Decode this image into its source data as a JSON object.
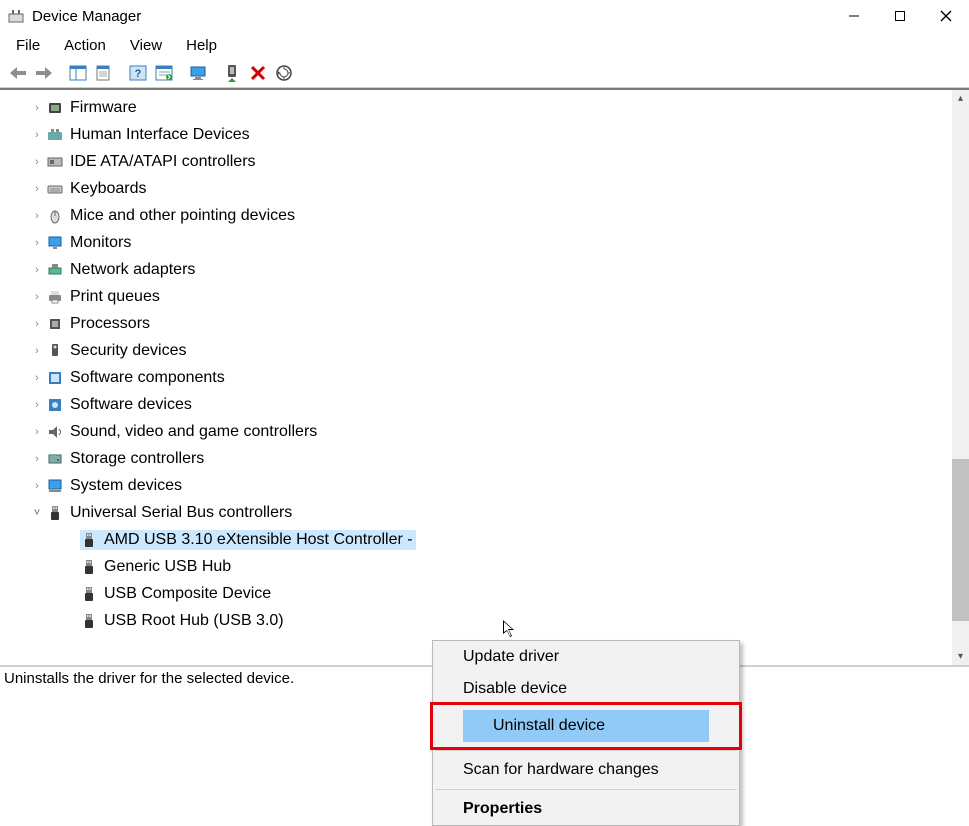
{
  "window": {
    "title": "Device Manager",
    "controls": {
      "minimize": "–",
      "maximize": "☐",
      "close": "✕"
    }
  },
  "menu": {
    "items": [
      "File",
      "Action",
      "View",
      "Help"
    ]
  },
  "toolbar": {
    "buttons": [
      {
        "name": "back",
        "glyph": "arrow-left"
      },
      {
        "name": "forward",
        "glyph": "arrow-right"
      },
      {
        "name": "show-hide-tree",
        "glyph": "panel"
      },
      {
        "name": "properties",
        "glyph": "prop-sheet"
      },
      {
        "name": "help",
        "glyph": "help"
      },
      {
        "name": "action-list",
        "glyph": "sheet"
      },
      {
        "name": "update-driver",
        "glyph": "monitor"
      },
      {
        "name": "enable-device",
        "glyph": "enable"
      },
      {
        "name": "uninstall-device",
        "glyph": "x-red"
      },
      {
        "name": "scan-hardware",
        "glyph": "scan"
      }
    ]
  },
  "tree": {
    "nodes": [
      {
        "label": "Firmware",
        "icon": "firmware",
        "expanded": false
      },
      {
        "label": "Human Interface Devices",
        "icon": "hid",
        "expanded": false
      },
      {
        "label": "IDE ATA/ATAPI controllers",
        "icon": "ide",
        "expanded": false
      },
      {
        "label": "Keyboards",
        "icon": "keyboard",
        "expanded": false
      },
      {
        "label": "Mice and other pointing devices",
        "icon": "mouse",
        "expanded": false
      },
      {
        "label": "Monitors",
        "icon": "monitor",
        "expanded": false
      },
      {
        "label": "Network adapters",
        "icon": "network",
        "expanded": false
      },
      {
        "label": "Print queues",
        "icon": "printer",
        "expanded": false
      },
      {
        "label": "Processors",
        "icon": "cpu",
        "expanded": false
      },
      {
        "label": "Security devices",
        "icon": "security",
        "expanded": false
      },
      {
        "label": "Software components",
        "icon": "swcomp",
        "expanded": false
      },
      {
        "label": "Software devices",
        "icon": "swdev",
        "expanded": false
      },
      {
        "label": "Sound, video and game controllers",
        "icon": "sound",
        "expanded": false
      },
      {
        "label": "Storage controllers",
        "icon": "storage",
        "expanded": false
      },
      {
        "label": "System devices",
        "icon": "system",
        "expanded": false
      },
      {
        "label": "Universal Serial Bus controllers",
        "icon": "usb",
        "expanded": true,
        "children": [
          {
            "label": "AMD USB 3.10 eXtensible Host Controller -",
            "icon": "usb",
            "selected": true
          },
          {
            "label": "Generic USB Hub",
            "icon": "usb"
          },
          {
            "label": "USB Composite Device",
            "icon": "usb"
          },
          {
            "label": "USB Root Hub (USB 3.0)",
            "icon": "usb"
          }
        ]
      }
    ]
  },
  "context_menu": {
    "items": [
      {
        "label": "Update driver",
        "kind": "item"
      },
      {
        "label": "Disable device",
        "kind": "item"
      },
      {
        "label": "Uninstall device",
        "kind": "item",
        "highlighted": true
      },
      {
        "kind": "sep"
      },
      {
        "label": "Scan for hardware changes",
        "kind": "item"
      },
      {
        "kind": "sep"
      },
      {
        "label": "Properties",
        "kind": "item",
        "bold": true
      }
    ]
  },
  "status_bar": {
    "text": "Uninstalls the driver for the selected device."
  }
}
